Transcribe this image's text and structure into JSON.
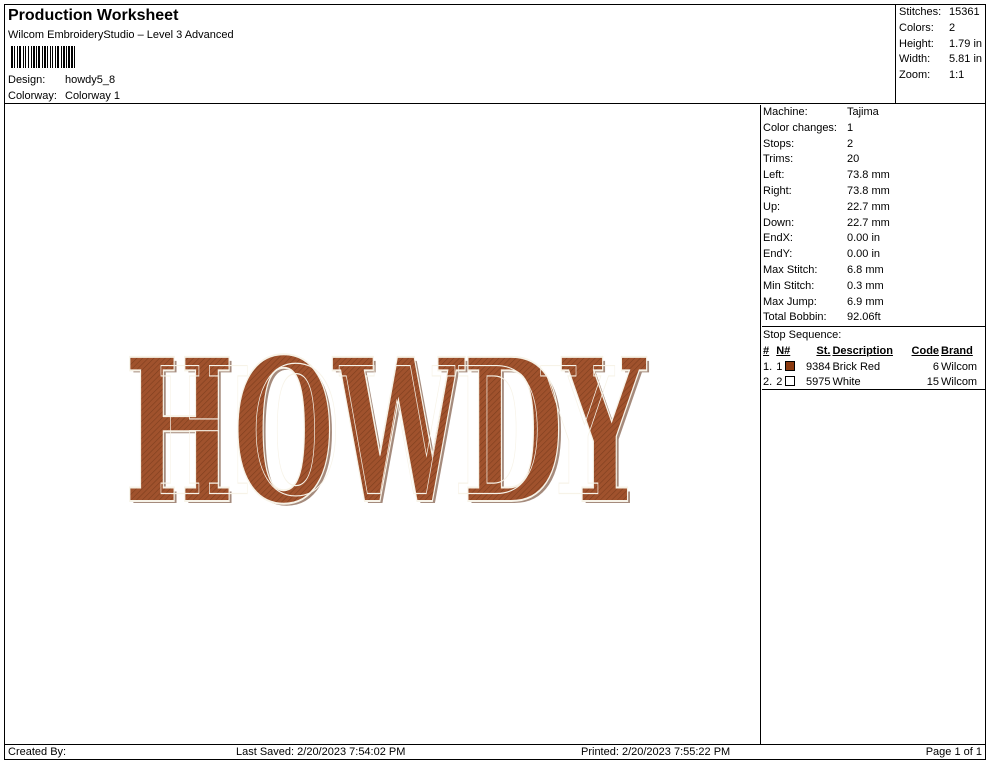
{
  "header": {
    "title": "Production Worksheet",
    "software": "Wilcom EmbroideryStudio – Level 3 Advanced",
    "design_label": "Design:",
    "design_value": "howdy5_8",
    "colorway_label": "Colorway:",
    "colorway_value": "Colorway 1"
  },
  "summary": [
    {
      "label": "Stitches:",
      "value": "15361"
    },
    {
      "label": "Colors:",
      "value": "2"
    },
    {
      "label": "Height:",
      "value": "1.79 in"
    },
    {
      "label": "Width:",
      "value": "5.81 in"
    },
    {
      "label": "Zoom:",
      "value": "1:1"
    }
  ],
  "details": [
    {
      "label": "Machine:",
      "value": "Tajima"
    },
    {
      "label": "Color changes:",
      "value": "1"
    },
    {
      "label": "Stops:",
      "value": "2"
    },
    {
      "label": "Trims:",
      "value": "20"
    },
    {
      "label": "Left:",
      "value": "73.8 mm"
    },
    {
      "label": "Right:",
      "value": "73.8 mm"
    },
    {
      "label": "Up:",
      "value": "22.7 mm"
    },
    {
      "label": "Down:",
      "value": "22.7 mm"
    },
    {
      "label": "EndX:",
      "value": "0.00 in"
    },
    {
      "label": "EndY:",
      "value": "0.00 in"
    },
    {
      "label": "Max Stitch:",
      "value": "6.8 mm"
    },
    {
      "label": "Min Stitch:",
      "value": "0.3 mm"
    },
    {
      "label": "Max Jump:",
      "value": "6.9 mm"
    },
    {
      "label": "Total Bobbin:",
      "value": "92.06ft"
    }
  ],
  "stop_sequence": {
    "title": "Stop Sequence:",
    "headers": {
      "num": "#",
      "n": "N#",
      "st": "St.",
      "description": "Description",
      "code": "Code",
      "brand": "Brand"
    },
    "rows": [
      {
        "num": "1.",
        "n": "1",
        "color": "#8B3A10",
        "st": "9384",
        "description": "Brick Red",
        "code": "6",
        "brand": "Wilcom"
      },
      {
        "num": "2.",
        "n": "2",
        "color": "#FFFFFF",
        "st": "5975",
        "description": "White",
        "code": "15",
        "brand": "Wilcom"
      }
    ]
  },
  "design": {
    "text": "HOWDY",
    "fill_color": "#A0522D",
    "outline_color": "#F7F3E8"
  },
  "footer": {
    "created_by": "Created By:",
    "last_saved": "Last Saved: 2/20/2023 7:54:02 PM",
    "printed": "Printed: 2/20/2023 7:55:22 PM",
    "page": "Page 1 of 1"
  }
}
